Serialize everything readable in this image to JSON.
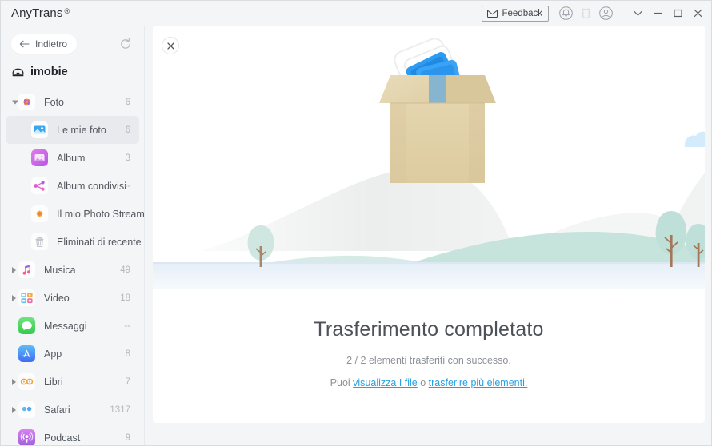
{
  "titlebar": {
    "brand": "AnyTrans",
    "registered_mark": "®",
    "feedback_label": "Feedback",
    "icons": {
      "envelope": "envelope-icon",
      "bell": "bell-icon",
      "gift": "gift-icon",
      "account": "account-icon",
      "chevron_down": "chevron-down-icon",
      "minimize": "minimize-icon",
      "maximize": "maximize-icon",
      "close": "close-icon"
    }
  },
  "sidebar": {
    "back_label": "Indietro",
    "refresh_label": "refresh-icon",
    "device_name": "imobie",
    "items": [
      {
        "label": "Foto",
        "count": "6",
        "level": 0,
        "caret": "down",
        "selected": false,
        "icon": "photos-icon"
      },
      {
        "label": "Le mie foto",
        "count": "6",
        "level": 1,
        "caret": "none",
        "selected": true,
        "icon": "my-photos-icon"
      },
      {
        "label": "Album",
        "count": "3",
        "level": 1,
        "caret": "none",
        "selected": false,
        "icon": "album-icon"
      },
      {
        "label": "Album condivisi",
        "count": "--",
        "level": 1,
        "caret": "none",
        "selected": false,
        "icon": "shared-album-icon"
      },
      {
        "label": "Il mio Photo Stream",
        "count": "--",
        "level": 1,
        "caret": "none",
        "selected": false,
        "icon": "photo-stream-icon"
      },
      {
        "label": "Eliminati di recente",
        "count": "--",
        "level": 1,
        "caret": "none",
        "selected": false,
        "icon": "trash-icon"
      },
      {
        "label": "Musica",
        "count": "49",
        "level": 0,
        "caret": "right",
        "selected": false,
        "icon": "music-icon"
      },
      {
        "label": "Video",
        "count": "18",
        "level": 0,
        "caret": "right",
        "selected": false,
        "icon": "video-icon"
      },
      {
        "label": "Messaggi",
        "count": "--",
        "level": 0,
        "caret": "none",
        "selected": false,
        "icon": "messages-icon"
      },
      {
        "label": "App",
        "count": "8",
        "level": 0,
        "caret": "none",
        "selected": false,
        "icon": "appstore-icon"
      },
      {
        "label": "Libri",
        "count": "7",
        "level": 0,
        "caret": "right",
        "selected": false,
        "icon": "books-icon"
      },
      {
        "label": "Safari",
        "count": "1317",
        "level": 0,
        "caret": "right",
        "selected": false,
        "icon": "safari-icon"
      },
      {
        "label": "Podcast",
        "count": "9",
        "level": 0,
        "caret": "none",
        "selected": false,
        "icon": "podcast-icon"
      }
    ]
  },
  "panel": {
    "close_label": "close-icon",
    "title": "Trasferimento completato",
    "subtitle": "2 / 2 elementi trasferiti con successo.",
    "links_prefix": "Puoi ",
    "link_view": "visualizza I file",
    "links_separator": " o ",
    "link_more": "trasferire più elementi.",
    "illustration": "transfer-complete-illustration"
  },
  "colors": {
    "window_bg": "#f4f5f7",
    "panel_bg": "#ffffff",
    "link": "#2a9fe0",
    "selected_row": "#e9eaee",
    "text_primary": "#4d5159",
    "text_muted": "#8d9198",
    "box_tan": "#dfcfa4",
    "tree_green": "#bfe0d8",
    "cloud_blue": "#d4ebfb"
  }
}
